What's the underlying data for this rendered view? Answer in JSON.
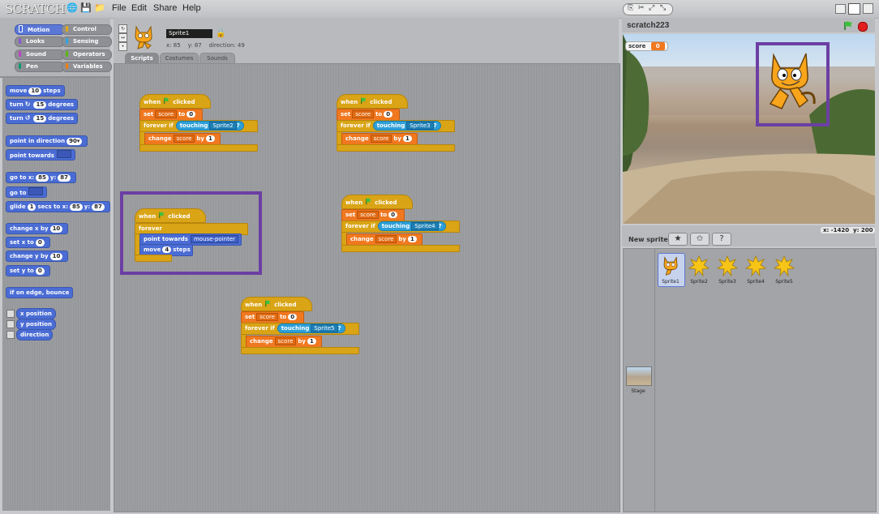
{
  "app": {
    "logo": "SCRATCH",
    "menu": [
      "File",
      "Edit",
      "Share",
      "Help"
    ]
  },
  "categories": [
    {
      "label": "Motion",
      "color": "#4a6cd4",
      "selected": true
    },
    {
      "label": "Control",
      "color": "#e1a91a"
    },
    {
      "label": "Looks",
      "color": "#8a55d7"
    },
    {
      "label": "Sensing",
      "color": "#2ca5e2"
    },
    {
      "label": "Sound",
      "color": "#bb42c3"
    },
    {
      "label": "Operators",
      "color": "#5cb712"
    },
    {
      "label": "Pen",
      "color": "#0e9a6c"
    },
    {
      "label": "Variables",
      "color": "#ee7d16"
    }
  ],
  "palette": {
    "move": {
      "a": "move",
      "n": "10",
      "b": "steps"
    },
    "turn_cw": {
      "a": "turn",
      "n": "15",
      "b": "degrees"
    },
    "turn_ccw": {
      "a": "turn",
      "n": "15",
      "b": "degrees"
    },
    "point_dir": {
      "a": "point in direction",
      "n": "90▾"
    },
    "point_towards": {
      "a": "point towards"
    },
    "goto_xy": {
      "a": "go to x:",
      "x": "85",
      "y_label": "y:",
      "y": "87"
    },
    "goto": {
      "a": "go to"
    },
    "glide": {
      "a": "glide",
      "n": "1",
      "b": "secs to x:",
      "x": "85",
      "y_label": "y:",
      "y": "87"
    },
    "change_x": {
      "a": "change x by",
      "n": "10"
    },
    "set_x": {
      "a": "set x to",
      "n": "0"
    },
    "change_y": {
      "a": "change y by",
      "n": "10"
    },
    "set_y": {
      "a": "set y to",
      "n": "0"
    },
    "bounce": {
      "a": "if on edge, bounce"
    },
    "x_pos": "x position",
    "y_pos": "y position",
    "direction": "direction"
  },
  "sprite": {
    "name": "Sprite1",
    "x_label": "x:",
    "x": "85",
    "y_label": "y:",
    "y": "87",
    "dir_label": "direction:",
    "dir": "49"
  },
  "tabs": [
    "Scripts",
    "Costumes",
    "Sounds"
  ],
  "scripts": {
    "when": "when",
    "clicked": "clicked",
    "set": "set",
    "to": "to",
    "forever_if": "forever if",
    "touching": "touching",
    "change": "change",
    "by": "by",
    "score": "score",
    "zero": "0",
    "one": "1",
    "forever": "forever",
    "point_towards": "point towards",
    "mouse_pointer": "mouse-pointer",
    "move": "move",
    "four": "4",
    "steps": "steps",
    "targets": [
      "Sprite2",
      "Sprite3",
      "Sprite4",
      "Sprite5"
    ]
  },
  "stage": {
    "title": "scratch223",
    "score_label": "score",
    "score_value": "0",
    "x_label": "x:",
    "x": "-1420",
    "y_label": "y:",
    "y": "200"
  },
  "sprites_panel": {
    "new_sprite": "New sprite:",
    "sprites": [
      "Sprite1",
      "Sprite2",
      "Sprite3",
      "Sprite4",
      "Sprite5"
    ],
    "stage_label": "Stage"
  },
  "colors": {
    "motion": "#4a6cd4",
    "control": "#d9a416",
    "variables": "#f07820",
    "sensing": "#2d9fd8",
    "highlight": "#6c3fa3"
  }
}
